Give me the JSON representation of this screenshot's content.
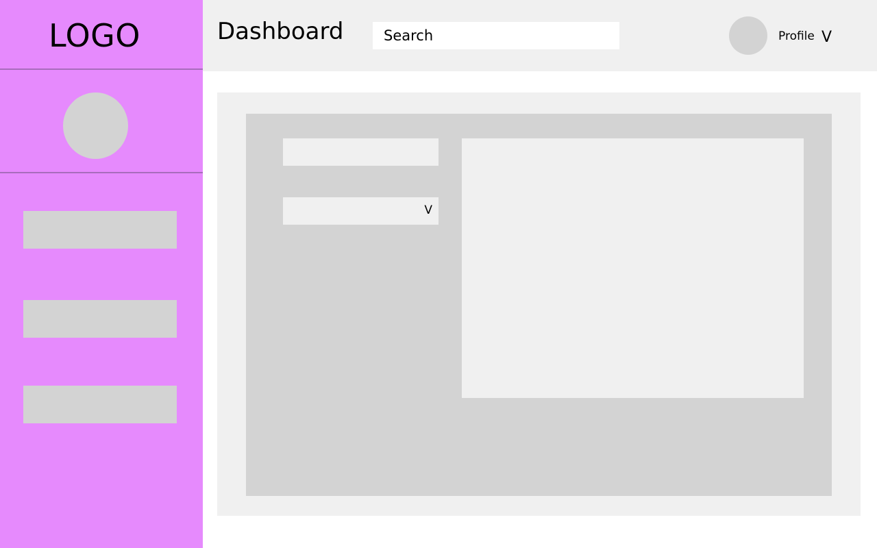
{
  "colors": {
    "sidebar_bg": "#e68afd",
    "divider": "#a86cbc",
    "placeholder_gray": "#d3d3d3",
    "light_gray": "#f0f0f0",
    "page_bg": "#ffffff"
  },
  "sidebar": {
    "logo_text": "LOGO",
    "avatar_icon": "user-avatar-placeholder",
    "items": [
      {
        "label": ""
      },
      {
        "label": ""
      },
      {
        "label": ""
      }
    ]
  },
  "header": {
    "title": "Dashboard",
    "search": {
      "placeholder": "Search",
      "value": ""
    },
    "profile": {
      "avatar_icon": "user-avatar-placeholder",
      "label": "Profile",
      "chevron": "V"
    }
  },
  "main": {
    "form": {
      "text_field": {
        "value": "",
        "placeholder": ""
      },
      "dropdown": {
        "selected": "",
        "chevron": "V"
      }
    }
  }
}
